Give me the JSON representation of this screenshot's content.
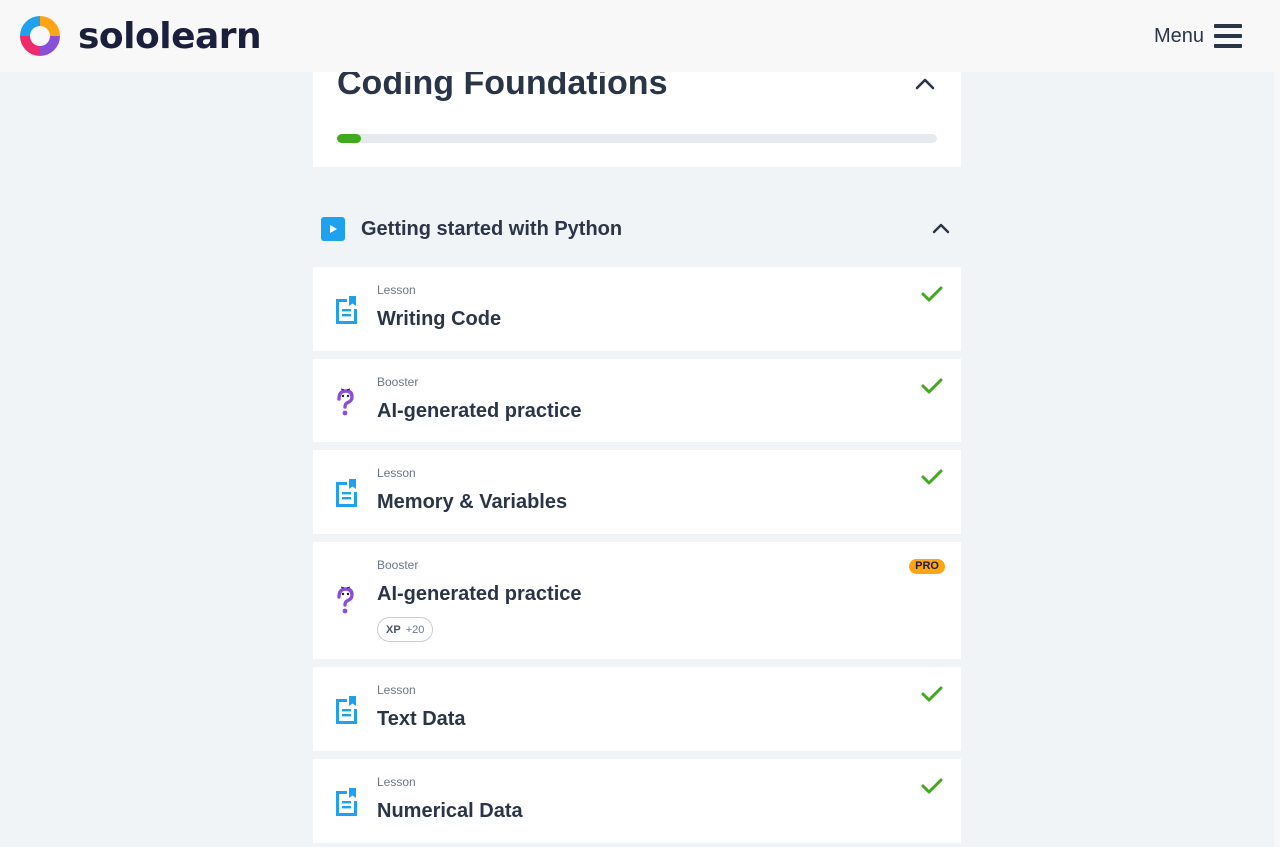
{
  "header": {
    "brand_name": "sololearn",
    "menu_label": "Menu"
  },
  "colors": {
    "accent_blue": "#1fa1f0",
    "success_green": "#3faa1c",
    "booster_purple": "#8a4fd8",
    "pro_orange": "#ffa415",
    "text_dark": "#2a3547"
  },
  "course": {
    "title": "Coding Foundations",
    "progress_percent": 4
  },
  "module": {
    "title": "Getting started with Python"
  },
  "lessons": [
    {
      "type": "Lesson",
      "title": "Writing Code",
      "icon": "document-icon",
      "completed": true
    },
    {
      "type": "Booster",
      "title": "AI-generated practice",
      "icon": "question-mark-icon",
      "completed": true
    },
    {
      "type": "Lesson",
      "title": "Memory & Variables",
      "icon": "document-icon",
      "completed": true
    },
    {
      "type": "Booster",
      "title": "AI-generated practice",
      "icon": "question-mark-icon",
      "completed": false,
      "badge": "PRO",
      "xp_label": "XP",
      "xp_value": "+20"
    },
    {
      "type": "Lesson",
      "title": "Text Data",
      "icon": "document-icon",
      "completed": true
    },
    {
      "type": "Lesson",
      "title": "Numerical Data",
      "icon": "document-icon",
      "completed": true
    }
  ]
}
